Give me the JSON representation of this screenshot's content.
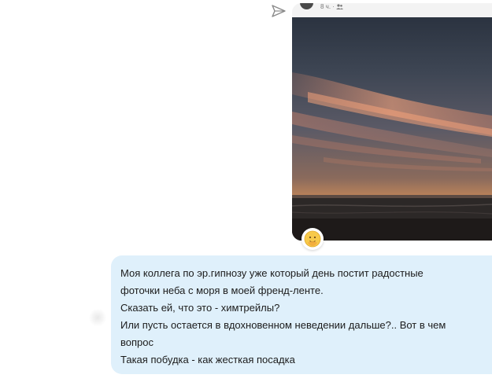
{
  "post": {
    "meta": "8 ч. ·",
    "audience_icon": "friends-icon"
  },
  "actions": {
    "forward_icon": "send-arrow-icon"
  },
  "reaction": {
    "icon": "care-emoji-icon"
  },
  "message": {
    "lines": [
      "Моя коллега по эр.гипнозу уже который день постит радостные",
      "фоточки неба с моря в моей френд-ленте.",
      "Сказать ей, что это - химтрейлы?",
      "Или пусть остается в вдохновенном неведении дальше?.. Вот в чем",
      "вопрос",
      "Такая побудка - как жесткая посадка"
    ]
  },
  "colors": {
    "bubble_bg": "#dff0fb",
    "text": "#1c1c1c",
    "meta_text": "#7a7a7a",
    "card_bg": "#f3f3f3"
  }
}
